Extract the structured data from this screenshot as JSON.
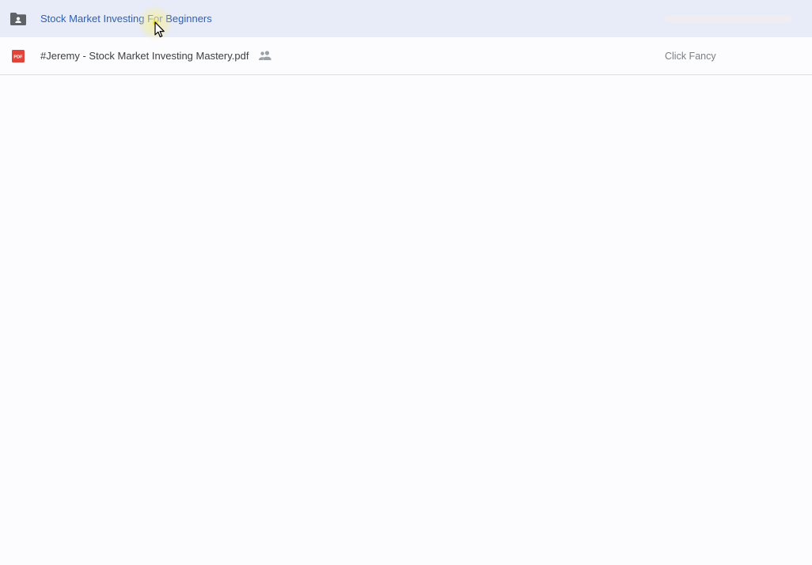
{
  "rows": [
    {
      "type": "shared-folder",
      "name": "Stock Market Investing For Beginners",
      "owner": "",
      "selected": true,
      "icon": "shared-folder-icon"
    },
    {
      "type": "pdf",
      "name": "#Jeremy - Stock Market Investing Mastery.pdf",
      "owner": "Click Fancy",
      "selected": false,
      "shared": true,
      "icon": "pdf-icon",
      "icon_label": "PDF"
    }
  ],
  "colors": {
    "selected_row_bg": "#e8ebf8",
    "selected_text": "#2f5fb0",
    "pdf_red": "#e0453c",
    "folder_gray": "#5f6368",
    "page_bg": "#fcfbfe"
  },
  "cursor": {
    "icon": "mouse-pointer-icon",
    "highlight": "cursor-click-highlight"
  }
}
